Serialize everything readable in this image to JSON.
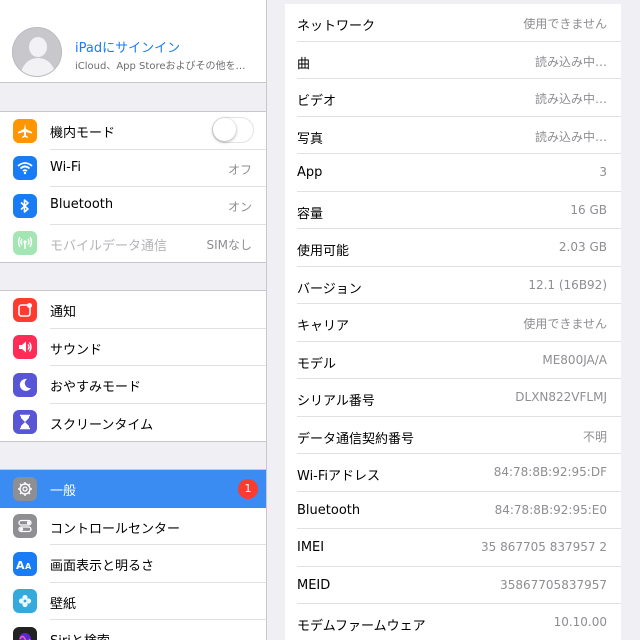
{
  "sidebar": {
    "profile": {
      "title": "iPadにサインイン",
      "subtitle": "iCloud、App Storeおよびその他を…"
    },
    "group1": [
      {
        "label": "機内モード",
        "icon": "airplane-icon",
        "color": "#ff9500",
        "toggle": false
      },
      {
        "label": "Wi-Fi",
        "value": "オフ",
        "icon": "wifi-icon",
        "color": "#1a7cf5"
      },
      {
        "label": "Bluetooth",
        "value": "オン",
        "icon": "bluetooth-icon",
        "color": "#1a7cf5"
      },
      {
        "label": "モバイルデータ通信",
        "value": "SIMなし",
        "icon": "cellular-icon",
        "color": "#34c759",
        "disabled": true
      }
    ],
    "group2": [
      {
        "label": "通知",
        "icon": "notifications-icon",
        "color": "#ff3b30"
      },
      {
        "label": "サウンド",
        "icon": "sound-icon",
        "color": "#ff2d55"
      },
      {
        "label": "おやすみモード",
        "icon": "moon-icon",
        "color": "#5856d6"
      },
      {
        "label": "スクリーンタイム",
        "icon": "hourglass-icon",
        "color": "#5856d6"
      }
    ],
    "group3": [
      {
        "label": "一般",
        "badge": "1",
        "icon": "gear-icon",
        "color": "#8e8e93",
        "selected": true
      },
      {
        "label": "コントロールセンター",
        "icon": "toggles-icon",
        "color": "#8e8e93"
      },
      {
        "label": "画面表示と明るさ",
        "icon": "display-icon",
        "color": "#1a7cf5"
      },
      {
        "label": "壁紙",
        "icon": "wallpaper-icon",
        "color": "#34aadc"
      },
      {
        "label": "Siriと検索",
        "icon": "siri-icon",
        "color": "#222222"
      }
    ]
  },
  "detail": {
    "rows": [
      {
        "key": "ネットワーク",
        "value": "使用できません"
      },
      {
        "key": "曲",
        "value": "読み込み中…"
      },
      {
        "key": "ビデオ",
        "value": "読み込み中…"
      },
      {
        "key": "写真",
        "value": "読み込み中…"
      },
      {
        "key": "App",
        "value": "3"
      },
      {
        "key": "容量",
        "value": "16 GB"
      },
      {
        "key": "使用可能",
        "value": "2.03 GB"
      },
      {
        "key": "バージョン",
        "value": "12.1 (16B92)"
      },
      {
        "key": "キャリア",
        "value": "使用できません"
      },
      {
        "key": "モデル",
        "value": "ME800JA/A"
      },
      {
        "key": "シリアル番号",
        "value": "DLXN822VFLMJ"
      },
      {
        "key": "データ通信契約番号",
        "value": "不明"
      },
      {
        "key": "Wi-Fiアドレス",
        "value": "84:78:8B:92:95:DF"
      },
      {
        "key": "Bluetooth",
        "value": "84:78:8B:92:95:E0"
      },
      {
        "key": "IMEI",
        "value": "35 867705 837957 2"
      },
      {
        "key": "MEID",
        "value": "35867705837957"
      },
      {
        "key": "モデムファームウェア",
        "value": "10.10.00"
      }
    ]
  }
}
